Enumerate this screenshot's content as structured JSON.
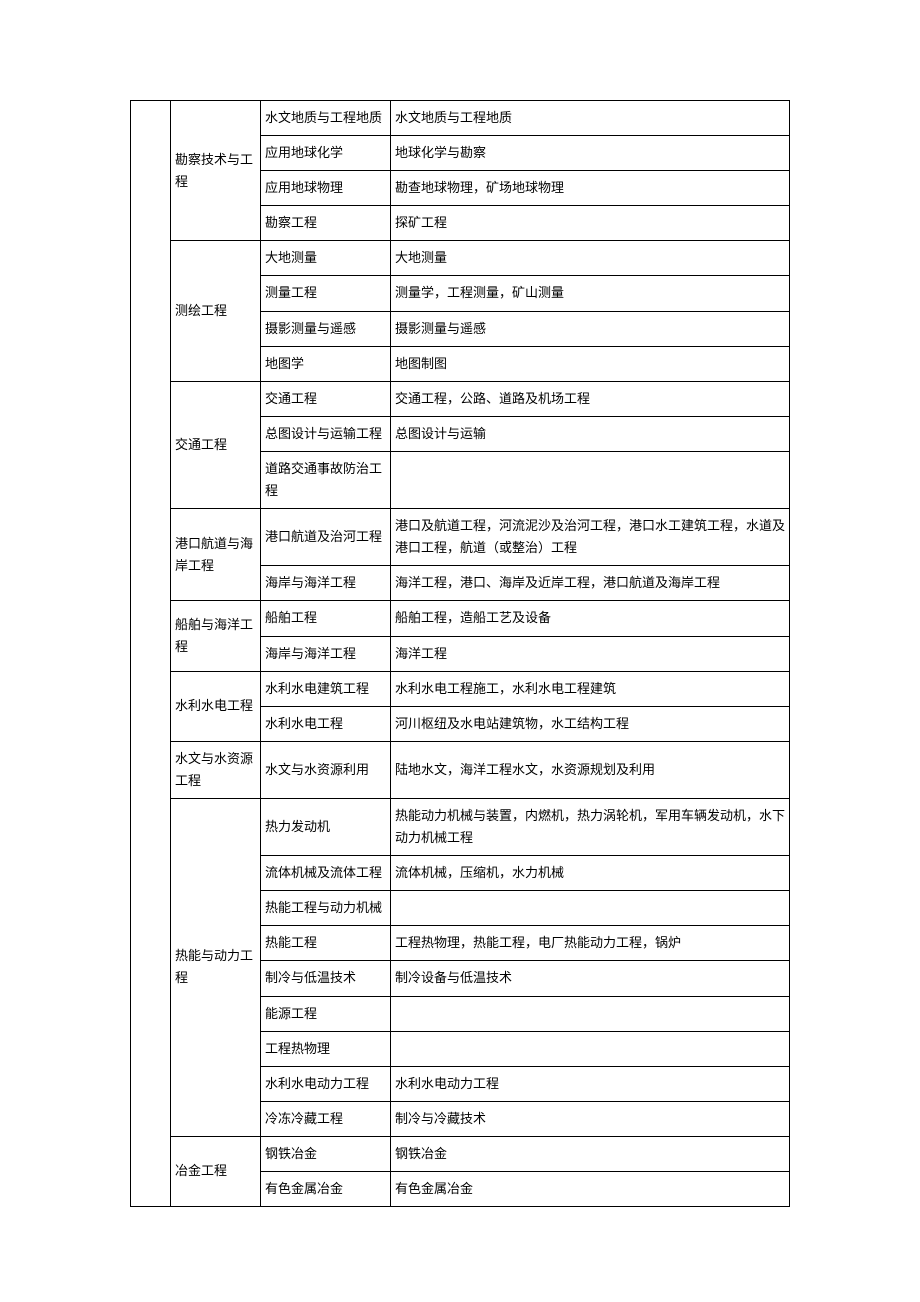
{
  "rows": [
    {
      "cat": "勘察技术与工程",
      "catSpan": 4,
      "c2": "水文地质与工程地质",
      "c3": "水文地质与工程地质"
    },
    {
      "c2": "应用地球化学",
      "c3": "地球化学与勘察"
    },
    {
      "c2": "应用地球物理",
      "c3": "勘查地球物理，矿场地球物理"
    },
    {
      "c2": "勘察工程",
      "c3": "探矿工程"
    },
    {
      "cat": "测绘工程",
      "catSpan": 4,
      "c2": "大地测量",
      "c3": "大地测量"
    },
    {
      "c2": "测量工程",
      "c3": "测量学，工程测量，矿山测量"
    },
    {
      "c2": "摄影测量与遥感",
      "c3": "摄影测量与遥感"
    },
    {
      "c2": "地图学",
      "c3": "地图制图"
    },
    {
      "cat": "交通工程",
      "catSpan": 3,
      "c2": "交通工程",
      "c3": "交通工程，公路、道路及机场工程"
    },
    {
      "c2": "总图设计与运输工程",
      "c3": "总图设计与运输"
    },
    {
      "c2": "道路交通事故防治工程",
      "c3": ""
    },
    {
      "cat": "港口航道与海岸工程",
      "catSpan": 2,
      "c2": "港口航道及治河工程",
      "c3": "港口及航道工程，河流泥沙及治河工程，港口水工建筑工程，水道及港口工程，航道（或整治）工程"
    },
    {
      "c2": "海岸与海洋工程",
      "c3": "海洋工程，港口、海岸及近岸工程，港口航道及海岸工程"
    },
    {
      "cat": "船舶与海洋工程",
      "catSpan": 2,
      "c2": "船舶工程",
      "c3": "船舶工程，造船工艺及设备"
    },
    {
      "c2": "海岸与海洋工程",
      "c3": "海洋工程"
    },
    {
      "cat": "水利水电工程",
      "catSpan": 2,
      "c2": "水利水电建筑工程",
      "c3": "水利水电工程施工，水利水电工程建筑"
    },
    {
      "c2": "水利水电工程",
      "c3": "河川枢纽及水电站建筑物，水工结构工程"
    },
    {
      "cat": "水文与水资源工程",
      "catSpan": 1,
      "c2": "水文与水资源利用",
      "c3": "陆地水文，海洋工程水文，水资源规划及利用"
    },
    {
      "cat": "热能与动力工程",
      "catSpan": 9,
      "c2": "热力发动机",
      "c3": "热能动力机械与装置，内燃机，热力涡轮机，军用车辆发动机，水下动力机械工程"
    },
    {
      "c2": "流体机械及流体工程",
      "c3": "流体机械，压缩机，水力机械"
    },
    {
      "c2": "热能工程与动力机械",
      "c3": ""
    },
    {
      "c2": "热能工程",
      "c3": "工程热物理，热能工程，电厂热能动力工程，锅炉"
    },
    {
      "c2": "制冷与低温技术",
      "c3": "制冷设备与低温技术"
    },
    {
      "c2": "能源工程",
      "c3": ""
    },
    {
      "c2": "工程热物理",
      "c3": ""
    },
    {
      "c2": "水利水电动力工程",
      "c3": "水利水电动力工程"
    },
    {
      "c2": "冷冻冷藏工程",
      "c3": "制冷与冷藏技术"
    },
    {
      "cat": "冶金工程",
      "catSpan": 2,
      "c2": "钢铁冶金",
      "c3": "钢铁冶金"
    },
    {
      "c2": "有色金属冶金",
      "c3": "有色金属冶金"
    }
  ]
}
